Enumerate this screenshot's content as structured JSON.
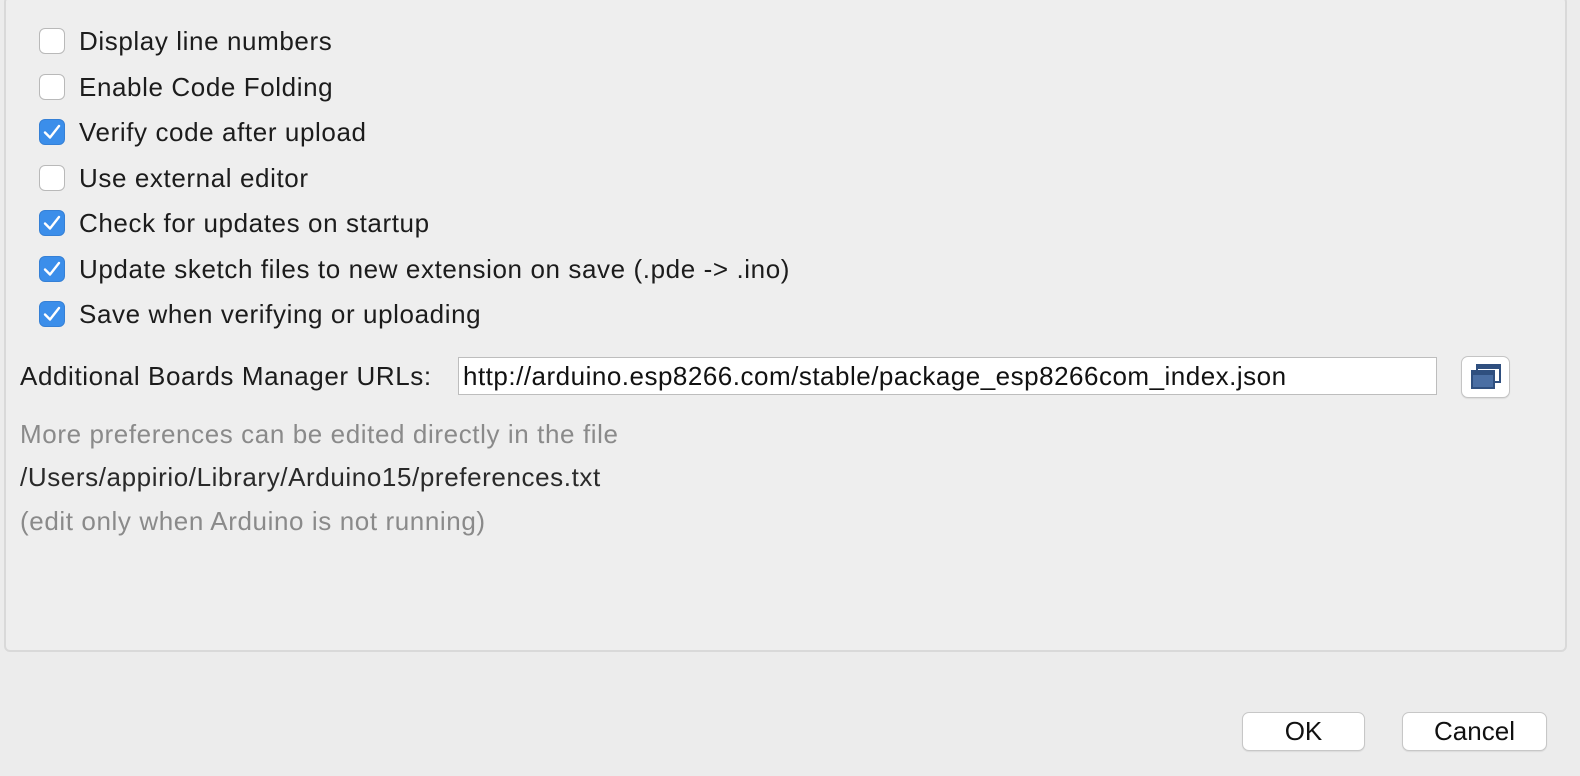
{
  "preferences": {
    "options": [
      {
        "label": "Display line numbers",
        "checked": false
      },
      {
        "label": "Enable Code Folding",
        "checked": false
      },
      {
        "label": "Verify code after upload",
        "checked": true
      },
      {
        "label": "Use external editor",
        "checked": false
      },
      {
        "label": "Check for updates on startup",
        "checked": true
      },
      {
        "label": "Update sketch files to new extension on save (.pde -> .ino)",
        "checked": true
      },
      {
        "label": "Save when verifying or uploading",
        "checked": true
      }
    ],
    "boards_manager": {
      "label": "Additional Boards Manager URLs:",
      "value": "http://arduino.esp8266.com/stable/package_esp8266com_index.json",
      "edit_button_icon": "window-stack-icon"
    },
    "info": {
      "line1": "More preferences can be edited directly in the file",
      "path": "/Users/appirio/Library/Arduino15/preferences.txt",
      "line3": "(edit only when Arduino is not running)"
    }
  },
  "dialog": {
    "ok_label": "OK",
    "cancel_label": "Cancel"
  },
  "colors": {
    "checked_blue": "#3b8eea",
    "background": "#eeeeee",
    "muted_text": "#8a8a8a",
    "icon_blue": "#4a6ea3"
  }
}
